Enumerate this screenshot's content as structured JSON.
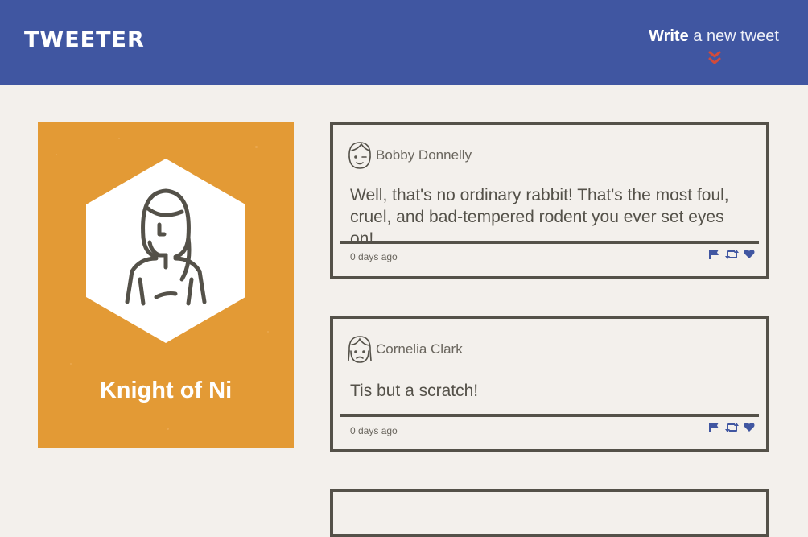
{
  "navbar": {
    "brand": "TWEETER",
    "compose_bold": "Write",
    "compose_rest": " a new tweet",
    "chevron_icon": "double-chevron-down-icon",
    "colors": {
      "background": "#4056a1",
      "chevron": "#d14b3b"
    }
  },
  "profile": {
    "name": "Knight of Ni",
    "avatar_icon": "long-hair-person-avatar-icon",
    "colors": {
      "card": "#e39a35",
      "hexagon": "#ffffff"
    }
  },
  "tweets": [
    {
      "author": "Bobby Donnelly",
      "content": "Well, that's no ordinary rabbit! That's the most foul, cruel, and bad-tempered rodent you ever set eyes on!",
      "time": "0 days ago",
      "avatar_icon": "winking-face-avatar-icon"
    },
    {
      "author": "Cornelia Clark",
      "content": "Tis but a scratch!",
      "time": "0 days ago",
      "avatar_icon": "frowning-face-avatar-icon"
    }
  ],
  "actions": {
    "icons": [
      "flag-icon",
      "retweet-icon",
      "heart-icon"
    ],
    "color": "#4056a1"
  },
  "colors": {
    "page_background": "#f3f0ec",
    "border": "#545149"
  }
}
